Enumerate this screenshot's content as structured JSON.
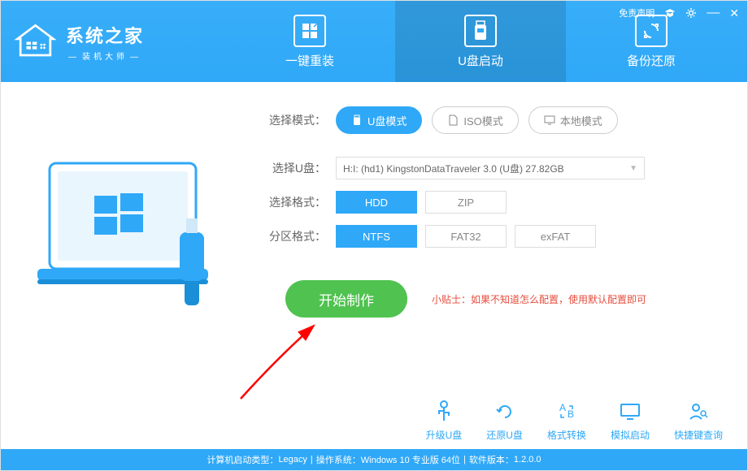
{
  "app": {
    "title": "系统之家",
    "subtitle": "装机大师",
    "disclaimer_link": "免责声明"
  },
  "top_tabs": [
    {
      "name": "reinstall",
      "label": "一键重装"
    },
    {
      "name": "usb-boot",
      "label": "U盘启动"
    },
    {
      "name": "backup",
      "label": "备份还原"
    }
  ],
  "modes": {
    "label": "选择模式：",
    "options": [
      {
        "name": "usb-mode",
        "label": "U盘模式",
        "selected": true
      },
      {
        "name": "iso-mode",
        "label": "ISO模式",
        "selected": false
      },
      {
        "name": "local-mode",
        "label": "本地模式",
        "selected": false
      }
    ]
  },
  "usb_select": {
    "label": "选择U盘：",
    "value": "H:I: (hd1) KingstonDataTraveler 3.0 (U盘) 27.82GB"
  },
  "format": {
    "label": "选择格式：",
    "options": [
      {
        "name": "hdd",
        "label": "HDD",
        "selected": true
      },
      {
        "name": "zip",
        "label": "ZIP",
        "selected": false
      }
    ]
  },
  "partition": {
    "label": "分区格式：",
    "options": [
      {
        "name": "ntfs",
        "label": "NTFS",
        "selected": true
      },
      {
        "name": "fat32",
        "label": "FAT32",
        "selected": false
      },
      {
        "name": "exfat",
        "label": "exFAT",
        "selected": false
      }
    ]
  },
  "start_button": "开始制作",
  "tip": {
    "label": "小贴士：",
    "text": "如果不知道怎么配置，使用默认配置即可"
  },
  "bottom_tools": [
    {
      "name": "upgrade-usb",
      "label": "升级U盘"
    },
    {
      "name": "restore-usb",
      "label": "还原U盘"
    },
    {
      "name": "format-convert",
      "label": "格式转换"
    },
    {
      "name": "simulate-boot",
      "label": "模拟启动"
    },
    {
      "name": "hotkey-lookup",
      "label": "快捷键查询"
    }
  ],
  "statusbar": {
    "boot_type_label": "计算机启动类型：",
    "boot_type": "Legacy",
    "os_label": "操作系统：",
    "os": "Windows 10 专业版 64位",
    "version_label": "软件版本：",
    "version": "1.2.0.0"
  }
}
